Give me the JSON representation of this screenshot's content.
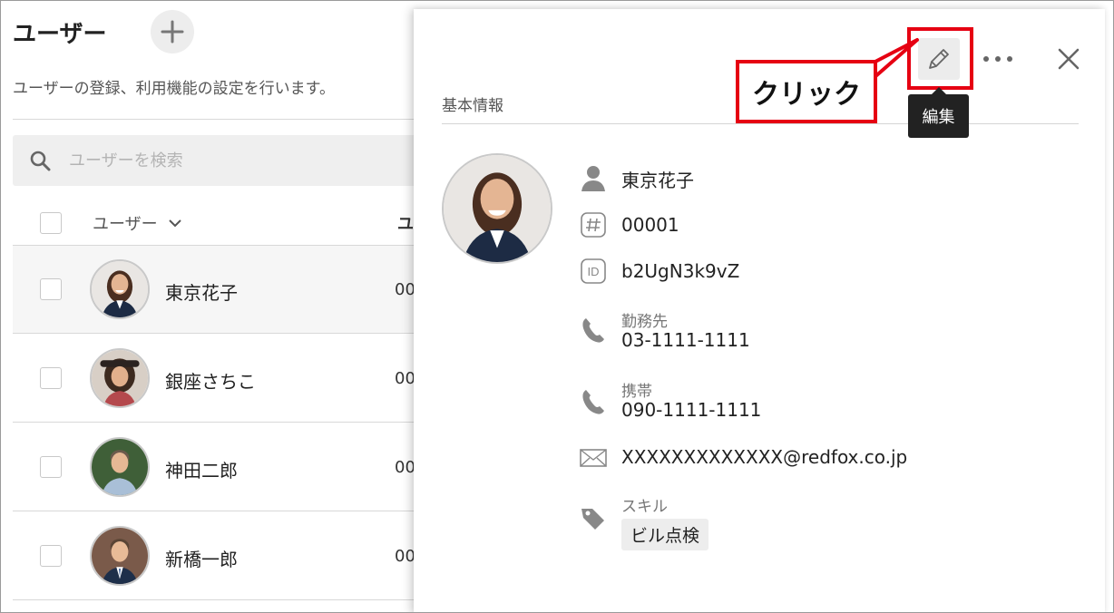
{
  "page": {
    "title": "ユーザー",
    "description": "ユーザーの登録、利用機能の設定を行います。",
    "search_placeholder": "ユーザーを検索"
  },
  "table": {
    "header_user": "ユーザー",
    "header_next": "ユ",
    "rows": [
      {
        "name": "東京花子",
        "code": "00"
      },
      {
        "name": "銀座さちこ",
        "code": "00"
      },
      {
        "name": "神田二郎",
        "code": "00"
      },
      {
        "name": "新橋一郎",
        "code": "00"
      }
    ]
  },
  "panel": {
    "section_title": "基本情報",
    "tooltip": "編集",
    "callout": "クリック",
    "name": "東京花子",
    "number": "00001",
    "id": "b2UgN3k9vZ",
    "work_label": "勤務先",
    "work_phone": "03-1111-1111",
    "mobile_label": "携帯",
    "mobile_phone": "090-1111-1111",
    "email": "XXXXXXXXXXXXX@redfox.co.jp",
    "skill_label": "スキル",
    "skill_tag": "ビル点検"
  },
  "colors": {
    "highlight_red": "#e60012",
    "tooltip_bg": "#222222",
    "icon_gray": "#888888"
  }
}
